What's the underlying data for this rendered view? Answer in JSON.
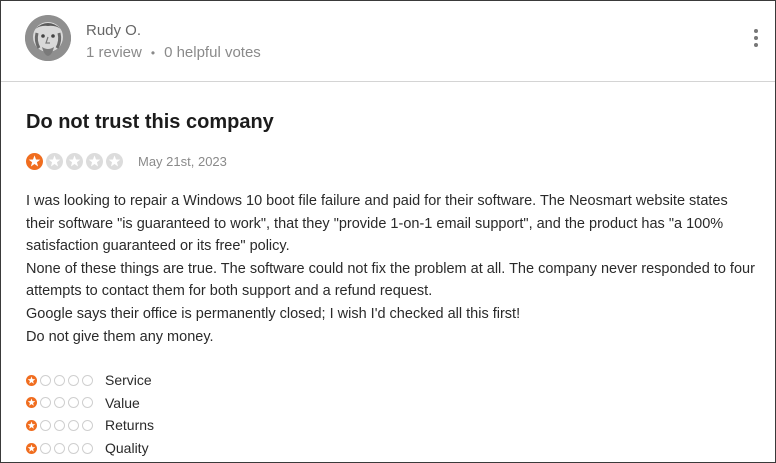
{
  "reviewer": {
    "name": "Rudy O.",
    "reviews": "1 review",
    "separator": "•",
    "helpful_votes": "0 helpful votes"
  },
  "review": {
    "title": "Do not trust this company",
    "rating": 1,
    "max_rating": 5,
    "date": "May 21st, 2023",
    "paragraphs": [
      "I was looking to repair a Windows 10 boot file failure and paid for their software. The Neosmart website states their software \"is guaranteed to work\", that they \"provide 1-on-1 email support\", and the product has \"a 100% satisfaction guaranteed or its free\" policy.",
      "None of these things are true. The software could not fix the problem at all. The company never responded to four attempts to contact them for both support and a refund request.",
      "Google says their office is permanently closed; I wish I'd checked all this first!",
      "Do not give them any money."
    ]
  },
  "sub_ratings": [
    {
      "label": "Service",
      "rating": 1
    },
    {
      "label": "Value",
      "rating": 1
    },
    {
      "label": "Returns",
      "rating": 1
    },
    {
      "label": "Quality",
      "rating": 1
    }
  ],
  "colors": {
    "star_filled": "#f06d1f",
    "star_empty": "#dcdcdc"
  },
  "icons": {
    "menu": "more-vertical-icon",
    "star": "star-icon"
  }
}
